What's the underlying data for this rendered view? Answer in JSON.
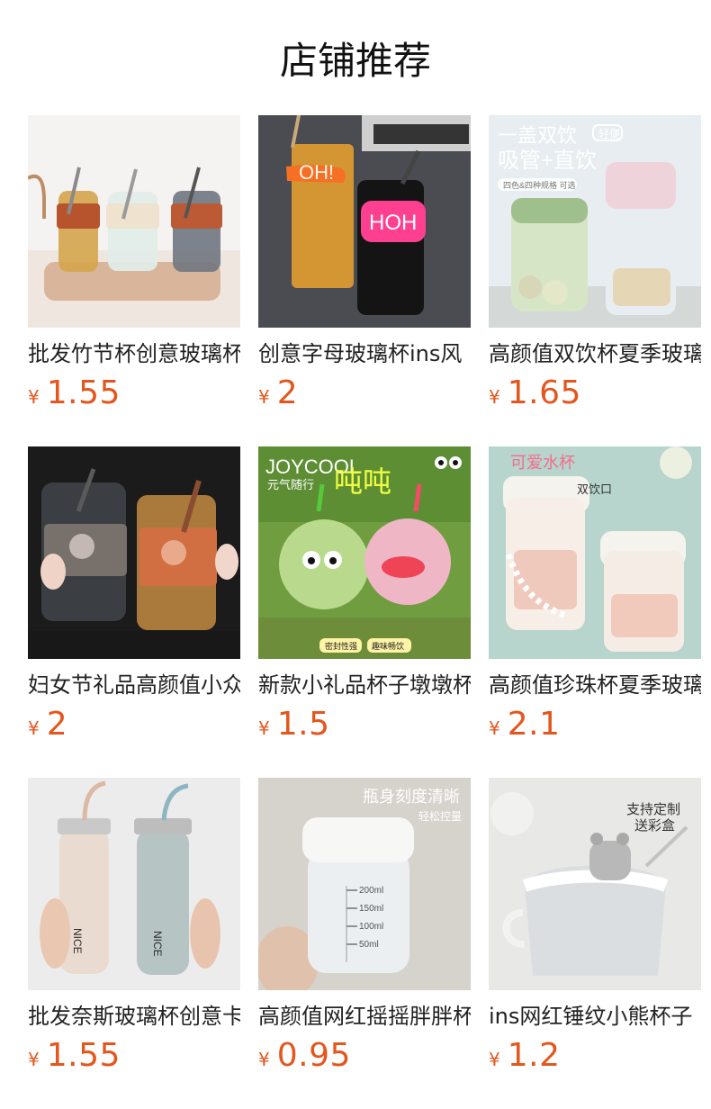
{
  "page_title": "店铺推荐",
  "currency_symbol": "¥",
  "products": [
    {
      "name": "批发竹节杯创意玻璃杯",
      "price": "1.55",
      "icon": "cup-product-image"
    },
    {
      "name": "创意字母玻璃杯ins风",
      "price": "2",
      "icon": "cup-product-image"
    },
    {
      "name": "高颜值双饮杯夏季玻璃",
      "price": "1.65",
      "icon": "cup-product-image",
      "overlay_title": "一盖双饮",
      "overlay_badge": "轻便",
      "overlay_subtitle": "吸管+直饮",
      "overlay_note": "四色&四种规格 可选"
    },
    {
      "name": "妇女节礼品高颜值小众",
      "price": "2",
      "icon": "cup-product-image"
    },
    {
      "name": "新款小礼品杯子墩墩杯",
      "price": "1.5",
      "icon": "cup-product-image",
      "overlay_title": "JOYCOOL",
      "overlay_subtitle": "元气随行",
      "overlay_big": "吨吨",
      "overlay_tag1": "密封性强",
      "overlay_tag2": "趣味畅饮"
    },
    {
      "name": "高颜值珍珠杯夏季玻璃",
      "price": "2.1",
      "icon": "cup-product-image",
      "overlay_title": "可爱水杯",
      "overlay_subtitle": "双饮口"
    },
    {
      "name": "批发奈斯玻璃杯创意卡",
      "price": "1.55",
      "icon": "bottle-product-image"
    },
    {
      "name": "高颜值网红摇摇胖胖杯",
      "price": "0.95",
      "icon": "cup-product-image",
      "overlay_title": "瓶身刻度清晰",
      "overlay_subtitle": "轻松控量"
    },
    {
      "name": "ins网红锤纹小熊杯子",
      "price": "1.2",
      "icon": "mug-product-image",
      "overlay_title": "支持定制",
      "overlay_subtitle": "送彩盒"
    }
  ],
  "colors": {
    "price": "#e4561d",
    "title": "#111111",
    "text": "#222222"
  }
}
